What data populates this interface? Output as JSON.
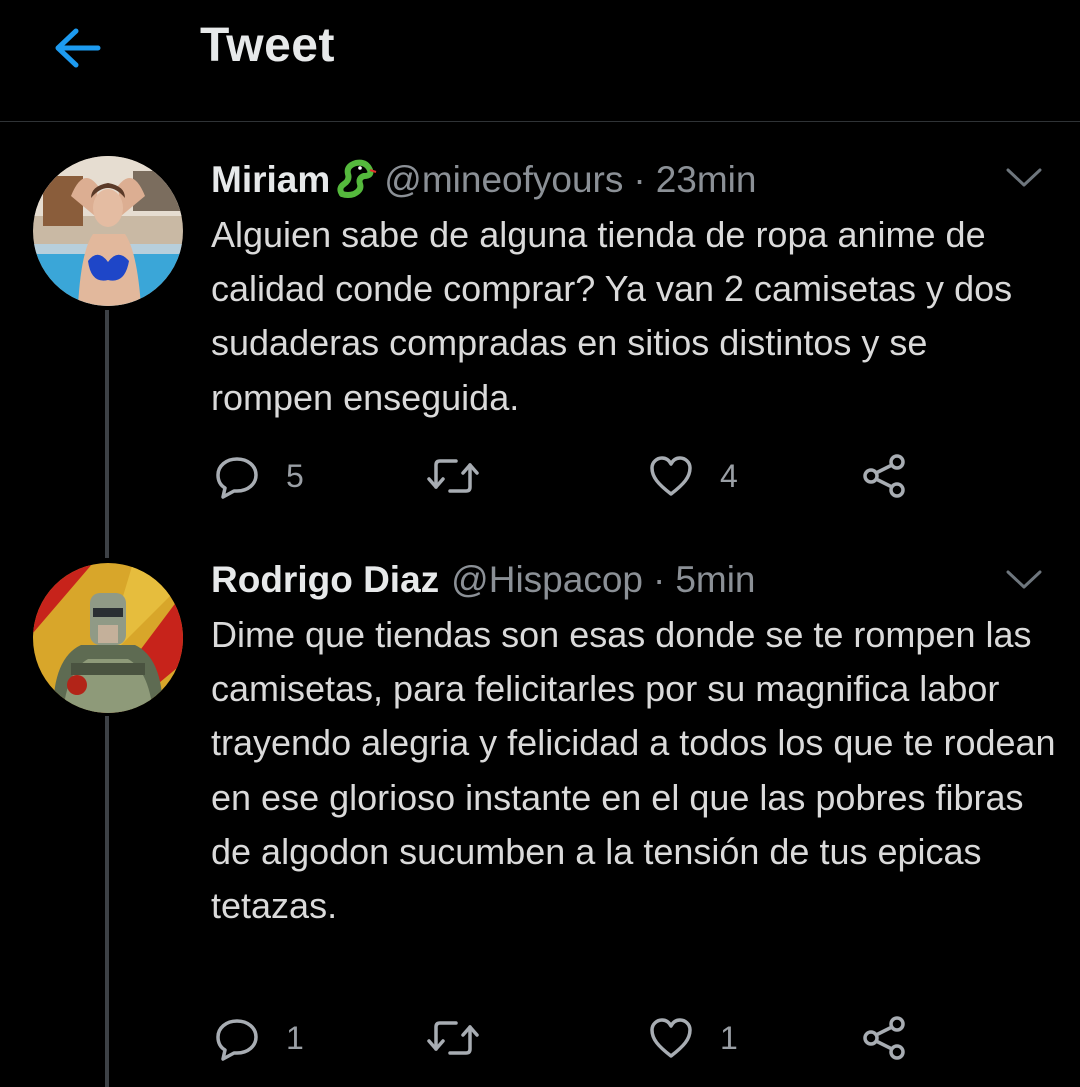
{
  "header": {
    "title": "Tweet",
    "back_icon": "arrow-left-icon",
    "accent_color": "#1d9bf0"
  },
  "tweets": [
    {
      "name": "Miriam",
      "emoji_icon": "snake-icon",
      "handle": "@mineofyours",
      "separator": "·",
      "time": "23min",
      "text": "Alguien sabe de alguna tienda de ropa anime de calidad conde comprar? Ya van 2 camisetas y dos sudaderas compradas en sitios distintos y se rompen enseguida.",
      "replies": "5",
      "retweets": "",
      "likes": "4"
    },
    {
      "name": "Rodrigo Diaz",
      "handle": "@Hispacop",
      "separator": "·",
      "time": "5min",
      "text": "Dime que tiendas son esas donde se te rompen las camisetas, para felicitarles por su magnifica labor trayendo alegria y felicidad a todos los que te rodean en ese glorioso instante en el que las pobres fibras de algodon sucumben a la tensión de tus epicas tetazas.",
      "replies": "1",
      "retweets": "",
      "likes": "1"
    }
  ]
}
